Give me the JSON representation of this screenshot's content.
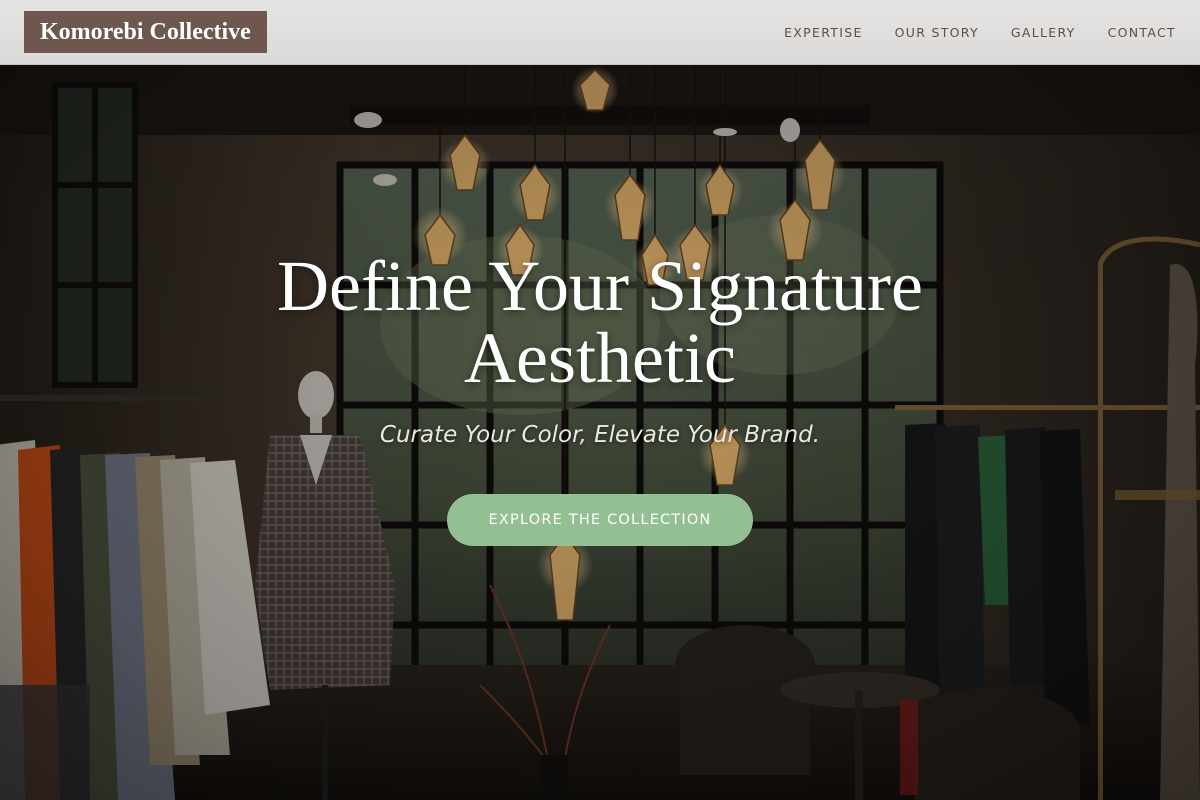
{
  "brand": {
    "name": "Komorebi Collective",
    "logo_bg": "#6e574d"
  },
  "nav": {
    "items": [
      {
        "label": "EXPERTISE"
      },
      {
        "label": "OUR STORY"
      },
      {
        "label": "GALLERY"
      },
      {
        "label": "CONTACT"
      }
    ]
  },
  "hero": {
    "title": "Define Your Signature Aesthetic",
    "subtitle": "Curate Your Color, Elevate Your Brand.",
    "cta_label": "EXPLORE THE COLLECTION",
    "cta_color": "#94bf92",
    "background": "clothing-boutique-interior-photo"
  }
}
